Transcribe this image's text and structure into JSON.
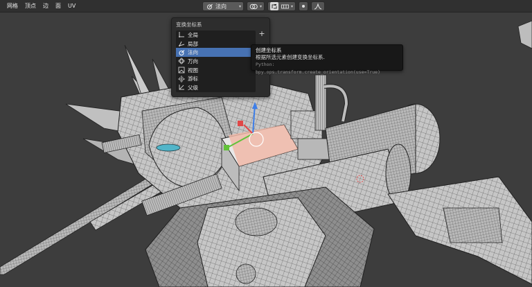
{
  "header": {
    "menus": [
      "",
      "网格",
      "顶点",
      "边",
      "面",
      "UV"
    ],
    "orientation": {
      "label": "法向",
      "icon": "normal-orientation-icon"
    },
    "pivot_icon": "pivot-point-icon",
    "snap_icon": "snap-icon",
    "proportional_icon": "proportional-edit-icon",
    "falloff_icon": "falloff-curve-icon"
  },
  "orientation_panel": {
    "title": "变换坐标系",
    "add_label": "+",
    "items": [
      {
        "label": "全局",
        "icon": "global-axes-icon",
        "selected": false
      },
      {
        "label": "局部",
        "icon": "local-axes-icon",
        "selected": false
      },
      {
        "label": "法向",
        "icon": "normal-orientation-icon",
        "selected": true
      },
      {
        "label": "万向",
        "icon": "gimbal-icon",
        "selected": false
      },
      {
        "label": "视图",
        "icon": "view-orientation-icon",
        "selected": false
      },
      {
        "label": "游标",
        "icon": "cursor-orientation-icon",
        "selected": false
      },
      {
        "label": "父级",
        "icon": "parent-orientation-icon",
        "selected": false
      }
    ]
  },
  "tooltip": {
    "title": "创建坐标系",
    "description": "根据所选元素创建变换坐标系.",
    "python": "Python: bpy.ops.transform.create_orientation(use=True)"
  },
  "colors": {
    "header_bg": "#303030",
    "viewport_bg": "#3d3d3d",
    "mesh_face": "#c9c9c9",
    "mesh_wire": "#2a2a2a",
    "selection": "#f0b9a8",
    "accent_blue": "#4772b3"
  }
}
